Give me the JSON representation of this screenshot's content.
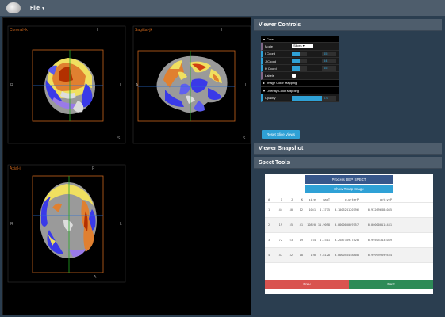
{
  "menu": {
    "file_label": "File"
  },
  "viewer": {
    "coronal": {
      "title": "Coronal-ik",
      "top": "I",
      "left": "R",
      "right": "L",
      "bottom": "S"
    },
    "sagittal": {
      "title": "Sagittal-jk",
      "top": "I",
      "left": "A",
      "right": "L",
      "bottom": "S"
    },
    "axial": {
      "title": "Axial-ij",
      "top": "P",
      "left": "R",
      "right": "L",
      "bottom": "A"
    }
  },
  "viewer_controls": {
    "title": "Viewer Controls",
    "core_label": "Core",
    "mode_label": "Mode",
    "mode_value": "Slices",
    "icoord_label": "I Coord",
    "icoord_value": "45",
    "icoord_fraction": 0.5,
    "jcoord_label": "J Coord",
    "jcoord_value": "54",
    "jcoord_fraction": 0.5,
    "kcoord_label": "K Coord",
    "kcoord_value": "45",
    "kcoord_fraction": 0.5,
    "labels_label": "Labels",
    "labels_checked": true,
    "image_mapping_label": "Image Color Mapping",
    "overlay_mapping_label": "Overlay Color Mapping",
    "opacity_label": "Opacity",
    "opacity_value": "0.6",
    "reset_button": "Reset Slice Views"
  },
  "snapshot": {
    "title": "Viewer Snapshot"
  },
  "spect_tools": {
    "title": "Spect Tools",
    "process_button": "Process DEP SPECT",
    "tmap_button": "Show Tmap Image",
    "columns": [
      "#",
      "I",
      "J",
      "K",
      "size",
      "maxT",
      "clusterP",
      "activeP"
    ],
    "rows": [
      [
        "1",
        "44",
        "40",
        "12",
        "1051",
        "4.3775",
        "0.150524120796",
        "0.932696884085"
      ],
      [
        "2",
        "19",
        "55",
        "41",
        "10820",
        "11.9098",
        "0.000000009757",
        "0.000000114441"
      ],
      [
        "3",
        "72",
        "63",
        "19",
        "744",
        "4.2311",
        "0.228738937528",
        "0.995053434049"
      ],
      [
        "4",
        "47",
        "42",
        "18",
        "190",
        "2.8128",
        "0.000058448808",
        "0.999999599434"
      ]
    ],
    "prev_button": "Prev",
    "next_button": "Next"
  },
  "colors": {
    "accent": "#2fa1d6",
    "navy": "#2b3e50",
    "panel": "#4e5d6c",
    "prev": "#d9534f",
    "next": "#2e8b57",
    "crosshair_h": "#2a6fd6",
    "crosshair_v": "#22aa22",
    "box": "#c8641c"
  }
}
